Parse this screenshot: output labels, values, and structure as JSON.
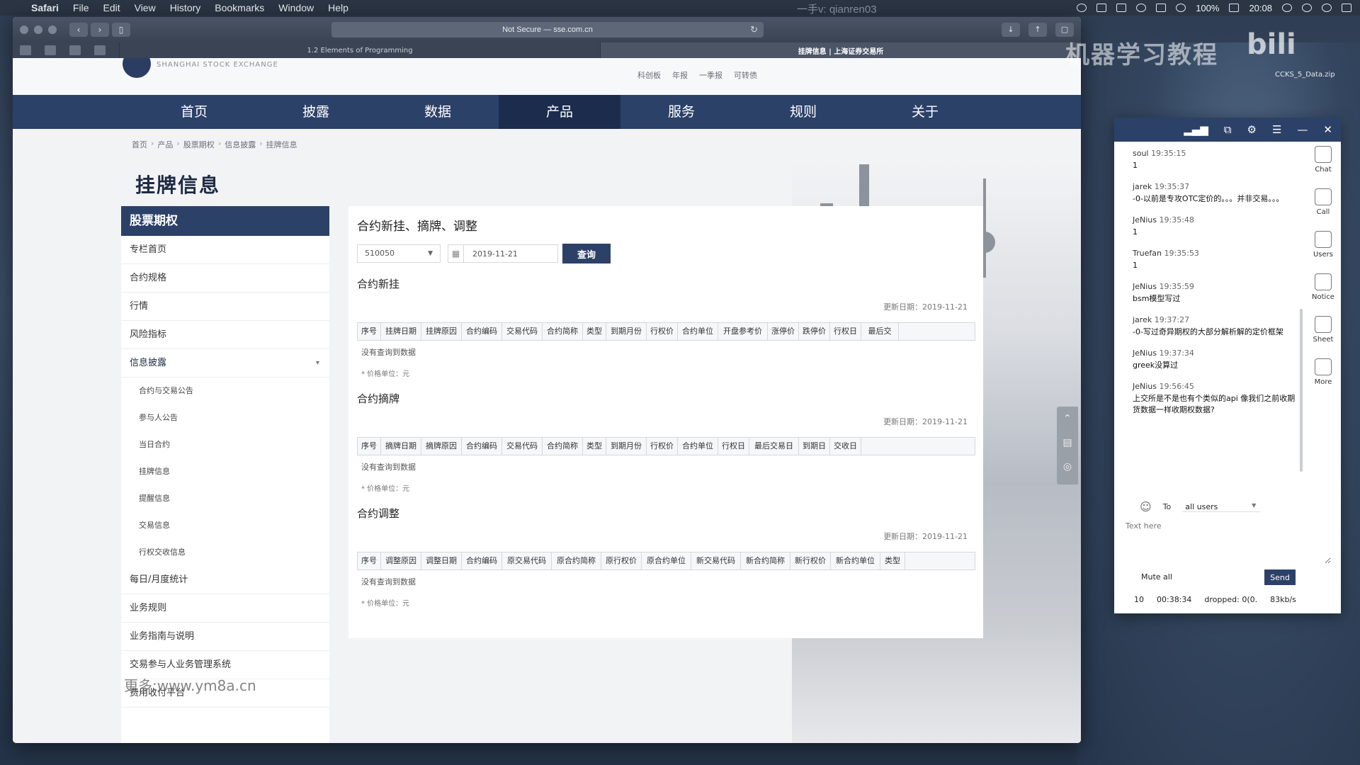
{
  "menubar": {
    "items": [
      "Safari",
      "File",
      "Edit",
      "View",
      "History",
      "Bookmarks",
      "Window",
      "Help"
    ],
    "watermark": "一手v: qianren03",
    "battery": "100%",
    "clock": "20:08"
  },
  "browser": {
    "address": "Not Secure — sse.com.cn",
    "tabs": [
      "1.2 Elements of Programming",
      "挂牌信息 | 上海证券交易所"
    ]
  },
  "site": {
    "logo_text": "SHANGHAI STOCK EXCHANGE",
    "top_links": [
      "科创板",
      "年报",
      "一季报",
      "可转债"
    ],
    "nav": [
      "首页",
      "披露",
      "数据",
      "产品",
      "服务",
      "规则",
      "关于"
    ],
    "breadcrumb": [
      "首页",
      "产品",
      "股票期权",
      "信息披露",
      "挂牌信息"
    ],
    "page_title": "挂牌信息"
  },
  "sidebar": {
    "header": "股票期权",
    "items_top": [
      "专栏首页",
      "合约规格",
      "行情",
      "风险指标"
    ],
    "open_item": "信息披露",
    "sub_items": [
      "合约与交易公告",
      "参与人公告",
      "当日合约",
      "挂牌信息",
      "提醒信息",
      "交易信息",
      "行权交收信息"
    ],
    "items_bottom": [
      "每日/月度统计",
      "业务规则",
      "业务指南与说明",
      "交易参与人业务管理系统",
      "费用收付平台"
    ],
    "watermark": "更多:www.ym8a.cn"
  },
  "panel": {
    "title": "合约新挂、摘牌、调整",
    "select_value": "510050",
    "date_value": "2019-11-21",
    "query_label": "查询",
    "sections": [
      {
        "title": "合约新挂",
        "updated": "更新日期：2019-11-21",
        "columns": [
          "序号",
          "挂牌日期",
          "挂牌原因",
          "合约编码",
          "交易代码",
          "合约简称",
          "类型",
          "到期月份",
          "行权价",
          "合约单位",
          "开盘参考价",
          "涨停价",
          "跌停价",
          "行权日",
          "最后交"
        ],
        "empty": "没有查询到数据",
        "unit": "* 价格单位：元"
      },
      {
        "title": "合约摘牌",
        "updated": "更新日期：2019-11-21",
        "columns": [
          "序号",
          "摘牌日期",
          "摘牌原因",
          "合约编码",
          "交易代码",
          "合约简称",
          "类型",
          "到期月份",
          "行权价",
          "合约单位",
          "行权日",
          "最后交易日",
          "到期日",
          "交收日"
        ],
        "empty": "没有查询到数据",
        "unit": "* 价格单位：元"
      },
      {
        "title": "合约调整",
        "updated": "更新日期：2019-11-21",
        "columns": [
          "序号",
          "调整原因",
          "调整日期",
          "合约编码",
          "原交易代码",
          "原合约简称",
          "原行权价",
          "原合约单位",
          "新交易代码",
          "新合约简称",
          "新行权价",
          "新合约单位",
          "类型"
        ],
        "empty": "没有查询到数据",
        "unit": "* 价格单位：元"
      }
    ]
  },
  "overlay": {
    "bili_text": "机器学习教程",
    "bili_logo": "bili",
    "desktop_file": "CCKS_5_Data.zip"
  },
  "chat": {
    "messages": [
      {
        "user": "soul",
        "time": "19:35:15",
        "text": "1"
      },
      {
        "user": "jarek",
        "time": "19:35:37",
        "text": "-0-以前是专攻OTC定价的。。。并非交易。。。"
      },
      {
        "user": "JeNius",
        "time": "19:35:48",
        "text": "1"
      },
      {
        "user": "Truefan",
        "time": "19:35:53",
        "text": "1"
      },
      {
        "user": "JeNius",
        "time": "19:35:59",
        "text": "bsm模型写过"
      },
      {
        "user": "jarek",
        "time": "19:37:27",
        "text": "-0-写过奇异期权的大部分解析解的定价框架"
      },
      {
        "user": "JeNius",
        "time": "19:37:34",
        "text": "greek没算过"
      },
      {
        "user": "JeNius",
        "time": "19:56:45",
        "text": "上交所是不是也有个类似的api 像我们之前收期货数据一样收期权数据?"
      }
    ],
    "rail": [
      "Chat",
      "Call",
      "Users",
      "Notice",
      "Sheet",
      "More"
    ],
    "to_label": "To",
    "to_value": "all users",
    "input_placeholder": "Text here",
    "mute_label": "Mute all",
    "send_label": "Send",
    "status": [
      "10",
      "00:38:34",
      "dropped: 0(0.",
      "83kb/s"
    ]
  }
}
